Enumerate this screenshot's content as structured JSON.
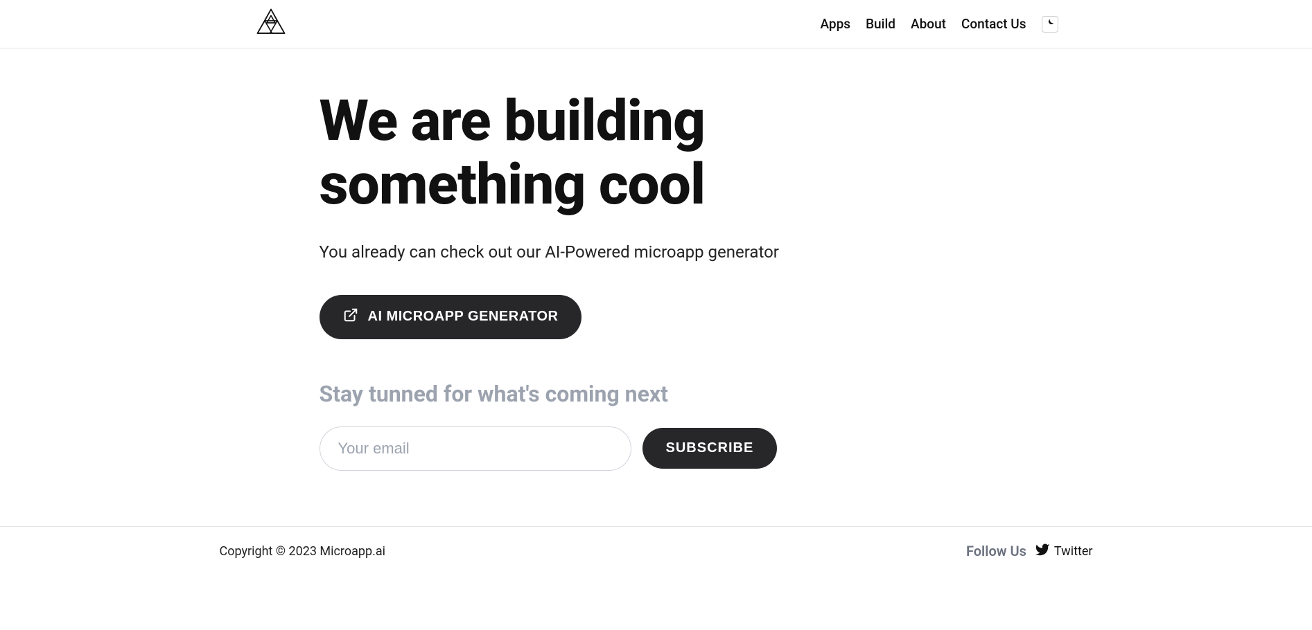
{
  "nav": {
    "items": [
      {
        "label": "Apps"
      },
      {
        "label": "Build"
      },
      {
        "label": "About"
      },
      {
        "label": "Contact Us"
      }
    ]
  },
  "hero": {
    "title": "We are building something cool",
    "subtitle": "You already can check out our AI-Powered microapp generator",
    "cta_label": "AI MICROAPP GENERATOR"
  },
  "subscribe": {
    "heading": "Stay tunned for what's coming next",
    "placeholder": "Your email",
    "button": "SUBSCRIBE"
  },
  "footer": {
    "copyright": "Copyright © 2023 Microapp.ai",
    "follow_label": "Follow Us",
    "twitter_label": "Twitter"
  }
}
